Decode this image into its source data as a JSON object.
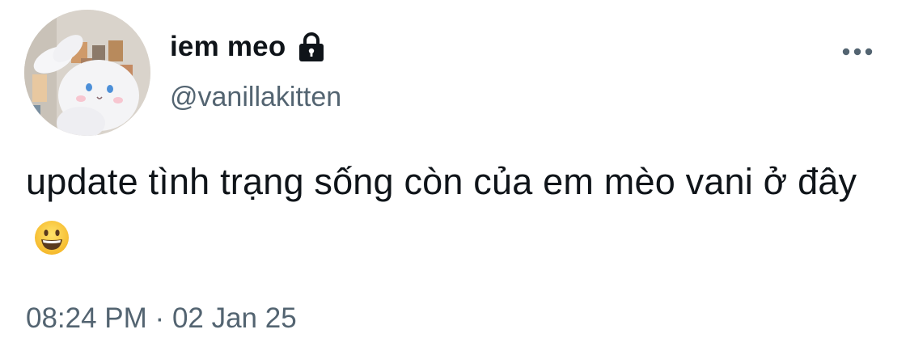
{
  "author": {
    "display_name": "iem meo",
    "handle": "@vanillakitten",
    "protected": true,
    "lock_icon": "lock-icon"
  },
  "header": {
    "more_icon": "more-dots-icon"
  },
  "tweet": {
    "text": "update tình trạng sống còn của em mèo vani ở đây",
    "emoji": "grinning-face-emoji"
  },
  "meta": {
    "time": "08:24 PM",
    "separator": "·",
    "date": "02 Jan 25"
  },
  "colors": {
    "primary_text": "#0f1419",
    "secondary_text": "#536471",
    "background": "#ffffff"
  }
}
